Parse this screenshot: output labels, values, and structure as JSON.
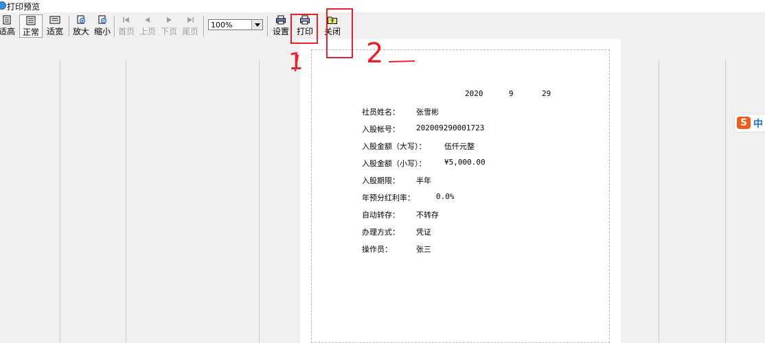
{
  "window": {
    "title": "打印预览"
  },
  "toolbar": {
    "buttons": [
      {
        "label": "适高",
        "icon": "fit-height-icon"
      },
      {
        "label": "正常",
        "icon": "normal-size-icon",
        "pressed": true
      },
      {
        "label": "适宽",
        "icon": "fit-width-icon"
      },
      {
        "label": "放大",
        "icon": "zoom-in-icon"
      },
      {
        "label": "缩小",
        "icon": "zoom-out-icon"
      },
      {
        "label": "首页",
        "icon": "first-page-icon",
        "disabled": true
      },
      {
        "label": "上页",
        "icon": "prev-page-icon",
        "disabled": true
      },
      {
        "label": "下页",
        "icon": "next-page-icon",
        "disabled": true
      },
      {
        "label": "尾页",
        "icon": "last-page-icon",
        "disabled": true
      },
      {
        "label": "设置",
        "icon": "settings-printer-icon"
      },
      {
        "label": "打印",
        "icon": "printer-icon"
      },
      {
        "label": "关闭",
        "icon": "close-folder-icon"
      }
    ],
    "zoom": {
      "value": "100%"
    }
  },
  "receipt": {
    "date_year": "2020",
    "date_month": "9",
    "date_day": "29",
    "rows": [
      {
        "label": "社员姓名：",
        "value": "张雪彬"
      },
      {
        "label": "入股帐号：",
        "value": "202009290001723"
      },
      {
        "label": "入股金额（大写）：",
        "value": "伍仟元整"
      },
      {
        "label": "入股金额（小写）：",
        "value": "¥5,000.00"
      },
      {
        "label": "入股期限：",
        "value": "半年"
      },
      {
        "label": "年预分红利率：",
        "value": "0.0%"
      },
      {
        "label": "自动转存：",
        "value": "不转存"
      },
      {
        "label": "办理方式：",
        "value": "凭证"
      },
      {
        "label": "操作员：",
        "value": "张三"
      }
    ]
  },
  "annotations": {
    "mark_1": "1",
    "mark_2": "2"
  },
  "ime": {
    "label": "中"
  },
  "colors": {
    "annotation_red": "#e8202a",
    "ime_orange": "#f05a1a"
  }
}
